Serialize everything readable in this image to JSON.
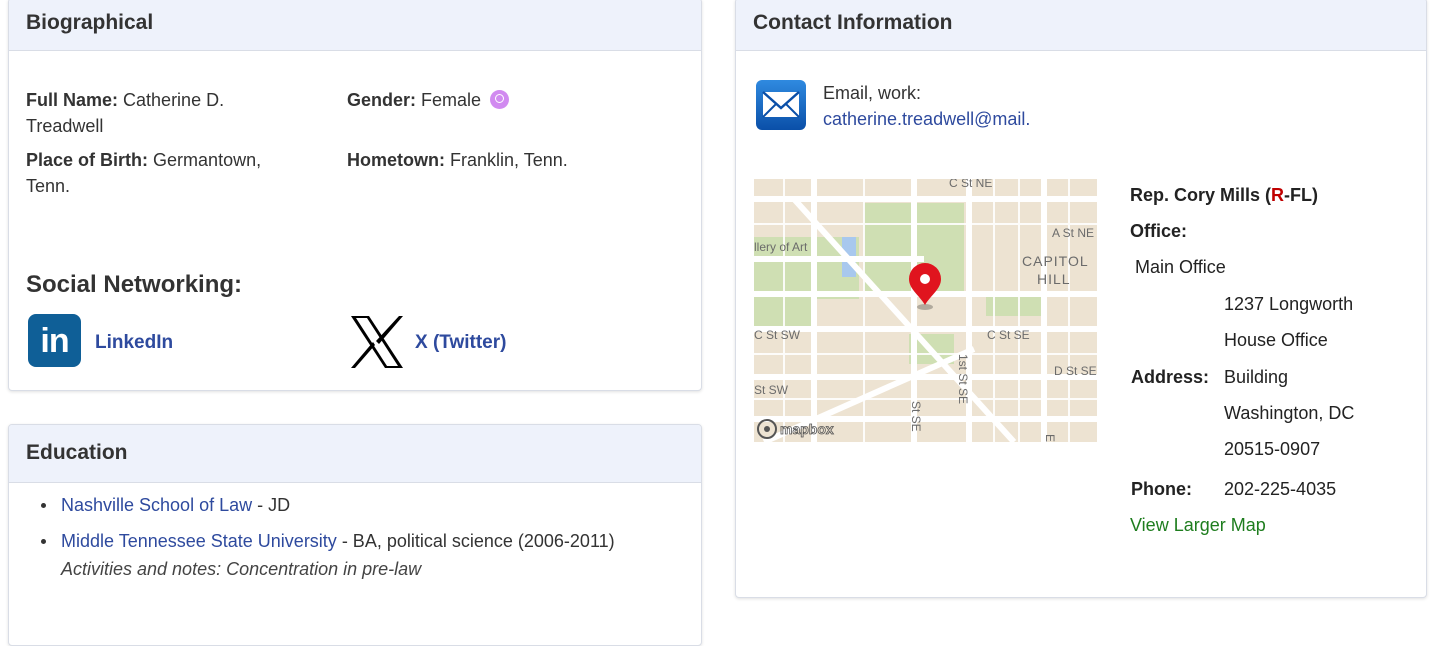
{
  "bio": {
    "header": "Biographical",
    "full_name_label": "Full Name:",
    "full_name_line1": "Catherine D.",
    "full_name_line2": "Treadwell",
    "gender_label": "Gender:",
    "gender_value": "Female",
    "pob_label": "Place of Birth:",
    "pob_line1": "Germantown,",
    "pob_line2": "Tenn.",
    "hometown_label": "Hometown:",
    "hometown_value": "Franklin, Tenn.",
    "social_title": "Social Networking:",
    "linkedin_icon_text": "in",
    "linkedin_label": "LinkedIn",
    "x_label": "X (Twitter)"
  },
  "education": {
    "header": "Education",
    "items": [
      {
        "school": "Nashville School of Law",
        "detail": " - JD"
      },
      {
        "school": "Middle Tennessee State University",
        "detail": " - BA, political science (2006-2011)",
        "note": "Activities and notes: Concentration in pre-law"
      }
    ]
  },
  "contact": {
    "header": "Contact Information",
    "email_label": "Email, work:",
    "email_value": "catherine.treadwell@mail.",
    "map_streets": [
      "C St NE",
      "llery of Art",
      "A St NE",
      "CAPITOL",
      "HILL",
      "C St SW",
      "C St SE",
      "D St SE",
      "St SW",
      "1st St SE",
      "St SE",
      "E"
    ],
    "map_brand": "mapbox",
    "rep_name": "Rep. Cory Mills (",
    "rep_party": "R",
    "rep_state": "-FL)",
    "office_label": "Office:",
    "office_name": "Main Office",
    "address_label": "Address:",
    "address_lines": [
      "1237 Longworth",
      "House Office",
      "Building",
      "Washington, DC",
      "20515-0907"
    ],
    "phone_label": "Phone:",
    "phone_value": "202-225-4035",
    "map_link": "View Larger Map"
  }
}
